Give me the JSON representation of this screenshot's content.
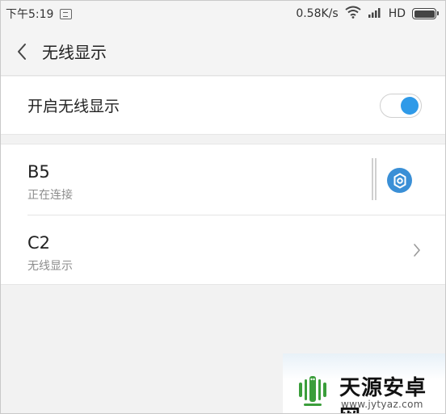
{
  "status_bar": {
    "time": "下午5:19",
    "net_speed": "0.58K/s",
    "network_type": "HD",
    "icons": [
      "notification-icon",
      "wifi-icon",
      "signal-icon",
      "battery-icon"
    ]
  },
  "header": {
    "back_icon": "chevron-left-icon",
    "title": "无线显示"
  },
  "toggle": {
    "label": "开启无线显示",
    "on": true,
    "accent": "#2f9ae8"
  },
  "devices": [
    {
      "name": "B5",
      "status": "正在连接",
      "action_icon": "settings-gear-icon"
    },
    {
      "name": "C2",
      "status": "无线显示",
      "action_icon": "chevron-right-icon"
    }
  ],
  "watermark": {
    "name": "天源安卓网",
    "url": "www.jytyaz.com",
    "logo_color": "#3b9e3b"
  }
}
